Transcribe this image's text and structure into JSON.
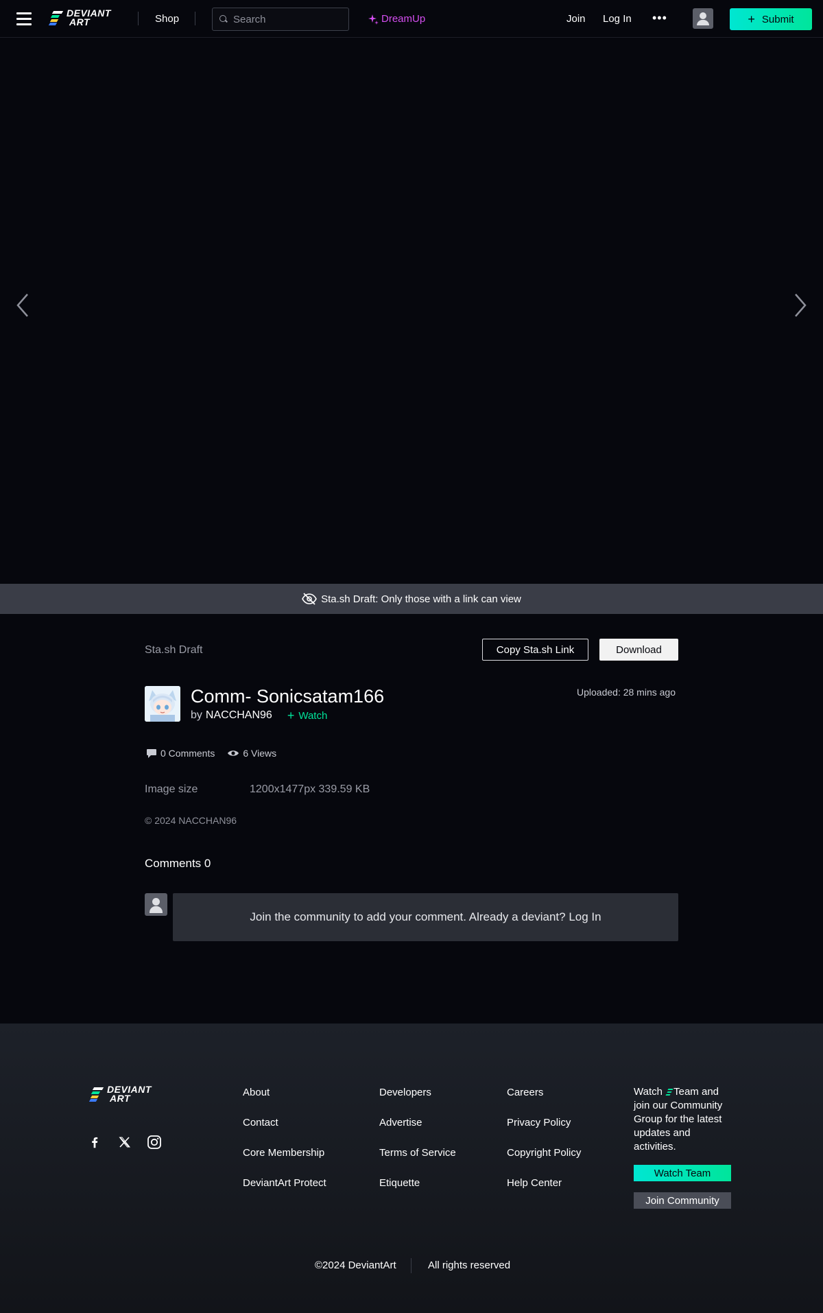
{
  "nav": {
    "logo_line1": "DEVIANT",
    "logo_line2": "ART",
    "shop": "Shop",
    "search_placeholder": "Search",
    "dreamup": "DreamUp",
    "join": "Join",
    "login": "Log In",
    "more": "•••",
    "submit": "Submit"
  },
  "draft_banner": "Sta.sh Draft: Only those with a link can view",
  "deviation": {
    "stash_label": "Sta.sh Draft",
    "copy_link": "Copy Sta.sh Link",
    "download": "Download",
    "title": "Comm- Sonicsatam166",
    "by": "by",
    "author": "NACCHAN96",
    "watch": "Watch",
    "uploaded": "Uploaded: 28 mins ago",
    "comments_stat": "0 Comments",
    "views_stat": "6 Views",
    "image_size_label": "Image size",
    "image_size_value": "1200x1477px 339.59 KB",
    "copyright": "© 2024 NACCHAN96"
  },
  "comments": {
    "heading": "Comments 0",
    "prompt": "Join the community to add your comment. Already a deviant? Log In"
  },
  "footer": {
    "logo_line1": "DEVIANT",
    "logo_line2": "ART",
    "col1": [
      "About",
      "Contact",
      "Core Membership",
      "DeviantArt Protect"
    ],
    "col2": [
      "Developers",
      "Advertise",
      "Terms of Service",
      "Etiquette"
    ],
    "col3": [
      "Careers",
      "Privacy Policy",
      "Copyright Policy",
      "Help Center"
    ],
    "blurb_before": "Watch",
    "blurb_after": "Team and join our Community Group for the latest updates and activities.",
    "watch_team": "Watch Team",
    "join_community": "Join Community",
    "copyright": "©2024 DeviantArt",
    "rights": "All rights reserved"
  },
  "icons": {
    "hamburger": "hamburger-icon",
    "search": "search-icon",
    "dreamup": "sparkle-icon",
    "avatar": "user-icon",
    "prev": "chevron-left-icon",
    "next": "chevron-right-icon",
    "draft": "eye-slash-icon",
    "comments": "comment-icon",
    "views": "eye-icon",
    "facebook": "facebook-icon",
    "x": "x-icon",
    "instagram": "instagram-icon"
  },
  "colors": {
    "accent": "#00e59b",
    "dreamup": "#d44ef0",
    "background": "#06070d",
    "banner": "#3a3d47"
  }
}
